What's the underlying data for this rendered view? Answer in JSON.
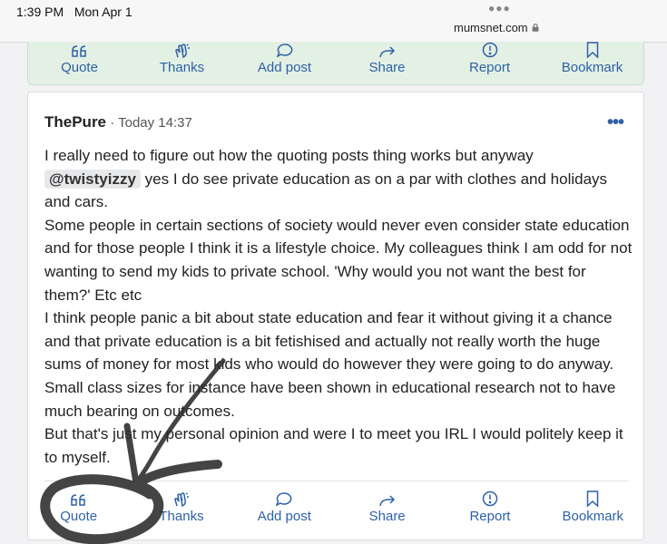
{
  "status_bar": {
    "time": "1:39 PM",
    "date": "Mon Apr 1",
    "url": "mumsnet.com"
  },
  "actions": {
    "quote": "Quote",
    "thanks": "Thanks",
    "add_post": "Add post",
    "share": "Share",
    "report": "Report",
    "bookmark": "Bookmark"
  },
  "post": {
    "author": "ThePure",
    "separator": "·",
    "timestamp": "Today 14:37",
    "more": "•••",
    "p1_before": "I really need to figure out how the quoting posts thing works but anyway ",
    "mention": "@twistyizzy",
    "p1_after": " yes I do see private education as on a par with clothes and holidays and cars.",
    "p2": "Some people in certain sections of society would never even consider state education and for those people I think it is a lifestyle choice. My colleagues think I am odd for not wanting to send my kids to private school. 'Why would you not want the best for them?' Etc etc",
    "p3": "I think people panic a bit about state education and fear it without giving it a chance and that private education is a bit fetishised and actually not really worth the huge sums of money for most kids who would do however they were going to do anyway. Small class sizes for instance have been shown in educational research not to have much bearing on outcomes.",
    "p4": "But that's just my personal opinion and were I to meet you IRL I would politely keep it to myself."
  },
  "colors": {
    "accent": "#2f61a6",
    "top_bar_bg": "#e3f0e4",
    "annotation": "#2b2b2b"
  }
}
